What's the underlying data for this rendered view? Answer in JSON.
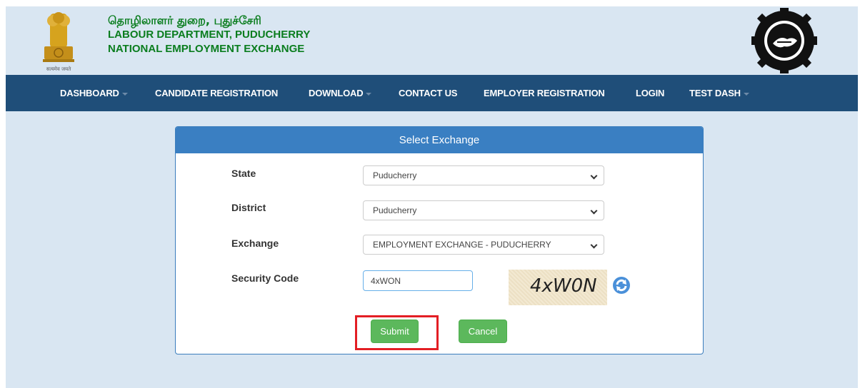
{
  "header": {
    "tamil_title": "தொழிலாளர் துறை, புதுச்சேரி",
    "line1": "LABOUR DEPARTMENT, PUDUCHERRY",
    "line2": "NATIONAL EMPLOYMENT EXCHANGE",
    "emblem_motto": "सत्यमेव जयते",
    "right_logo_icon": "national-employment-services-logo"
  },
  "nav": {
    "items": [
      {
        "label": "DASHBOARD",
        "dropdown": true
      },
      {
        "label": "CANDIDATE REGISTRATION",
        "dropdown": false
      },
      {
        "label": "DOWNLOAD",
        "dropdown": true
      },
      {
        "label": "CONTACT US",
        "dropdown": false
      },
      {
        "label": "EMPLOYER REGISTRATION",
        "dropdown": false
      },
      {
        "label": "LOGIN",
        "dropdown": false
      },
      {
        "label": "TEST DASH",
        "dropdown": true
      }
    ]
  },
  "panel": {
    "title": "Select Exchange",
    "state_label": "State",
    "state_value": "Puducherry",
    "district_label": "District",
    "district_value": "Puducherry",
    "exchange_label": "Exchange",
    "exchange_value": "EMPLOYMENT EXCHANGE - PUDUCHERRY",
    "security_label": "Security Code",
    "security_value": "4xWON",
    "captcha_text": "4xW0N",
    "submit_label": "Submit",
    "cancel_label": "Cancel"
  },
  "colors": {
    "navbar": "#1f4e79",
    "panel_header": "#3a7fc2",
    "button_green": "#5cb85c",
    "highlight_red": "#e31e24",
    "title_green": "#0a7d1e",
    "background": "#d9e6f2"
  }
}
